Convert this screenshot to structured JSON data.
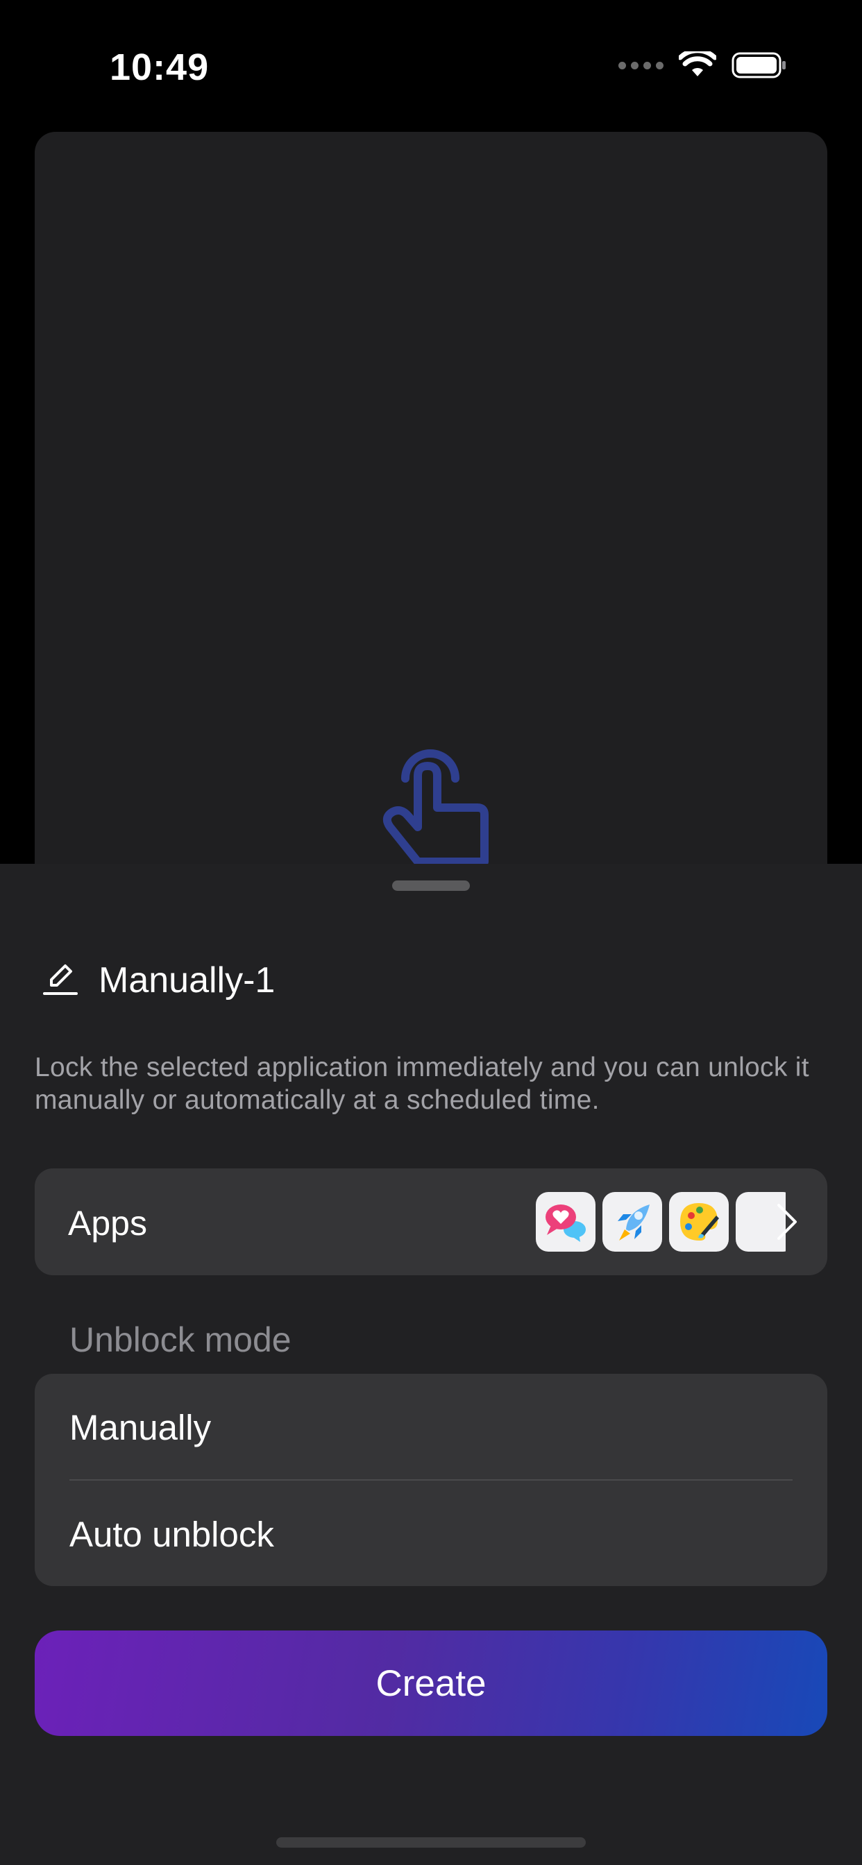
{
  "status_bar": {
    "time": "10:49"
  },
  "preview": {
    "icon": "tap-hand-icon",
    "icon_color": "#2f3f8f"
  },
  "profile": {
    "name": "Manually-1",
    "edit_icon": "pencil-icon"
  },
  "description": "Lock the selected application immediately and you can unlock it manually or automatically at a scheduled time.",
  "apps": {
    "label": "Apps",
    "icons": [
      "chat-heart-icon",
      "rocket-icon",
      "palette-icon",
      "partial-app-icon"
    ],
    "chevron": "chevron-right-icon"
  },
  "unblock": {
    "section_label": "Unblock mode",
    "options": [
      "Manually",
      "Auto unblock"
    ]
  },
  "create_button": {
    "label": "Create"
  },
  "colors": {
    "background": "#000000",
    "sheet": "#212123",
    "card": "#353537",
    "button_gradient_start": "#6c21b9",
    "button_gradient_end": "#1849b8"
  }
}
